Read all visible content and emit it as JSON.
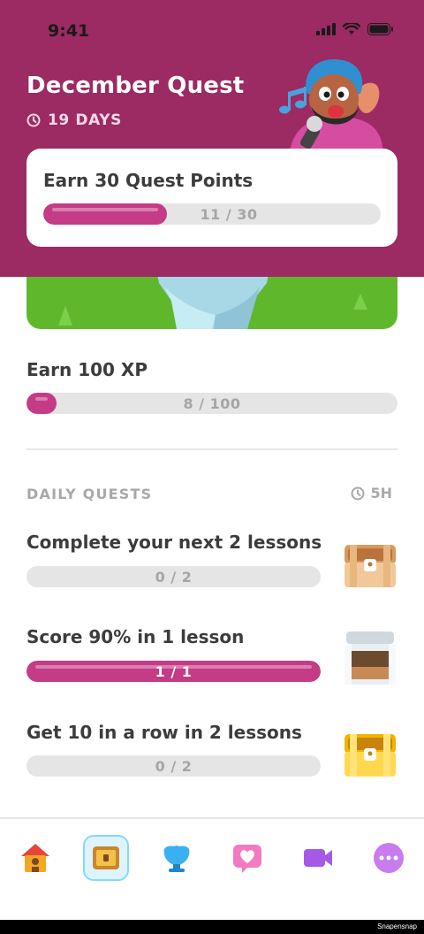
{
  "status_bar": {
    "time": "9:41"
  },
  "quest": {
    "title": "December Quest",
    "days_left": "19 DAYS",
    "main_goal": {
      "label": "Earn 30 Quest Points",
      "progress_text": "11 / 30",
      "progress": 0.367
    }
  },
  "goals": [
    {
      "label": "Earn 100 XP",
      "progress_text": "8 / 100",
      "progress": 0.08
    }
  ],
  "daily_quests": {
    "header": "DAILY QUESTS",
    "time_left": "5H",
    "items": [
      {
        "label": "Complete your next 2 lessons",
        "progress_text": "0 / 2",
        "progress": 0.0,
        "chest": "bronze-chest-icon"
      },
      {
        "label": "Score 90% in 1 lesson",
        "progress_text": "1 / 1",
        "progress": 1.0,
        "chest": "silver-chest-open-icon"
      },
      {
        "label": "Get 10 in a row in 2 lessons",
        "progress_text": "0 / 2",
        "progress": 0.0,
        "chest": "gold-chest-icon"
      }
    ]
  },
  "bottom_nav": {
    "items": [
      "home-icon",
      "quests-icon",
      "leagues-icon",
      "hearts-icon",
      "video-icon",
      "more-icon"
    ],
    "active": "quests-icon"
  },
  "watermark": "Snapensnap",
  "colors": {
    "header": "#9c2a63",
    "progress_fill": "#c43b86",
    "track": "#e5e5e5",
    "grass": "#5fb82c"
  }
}
